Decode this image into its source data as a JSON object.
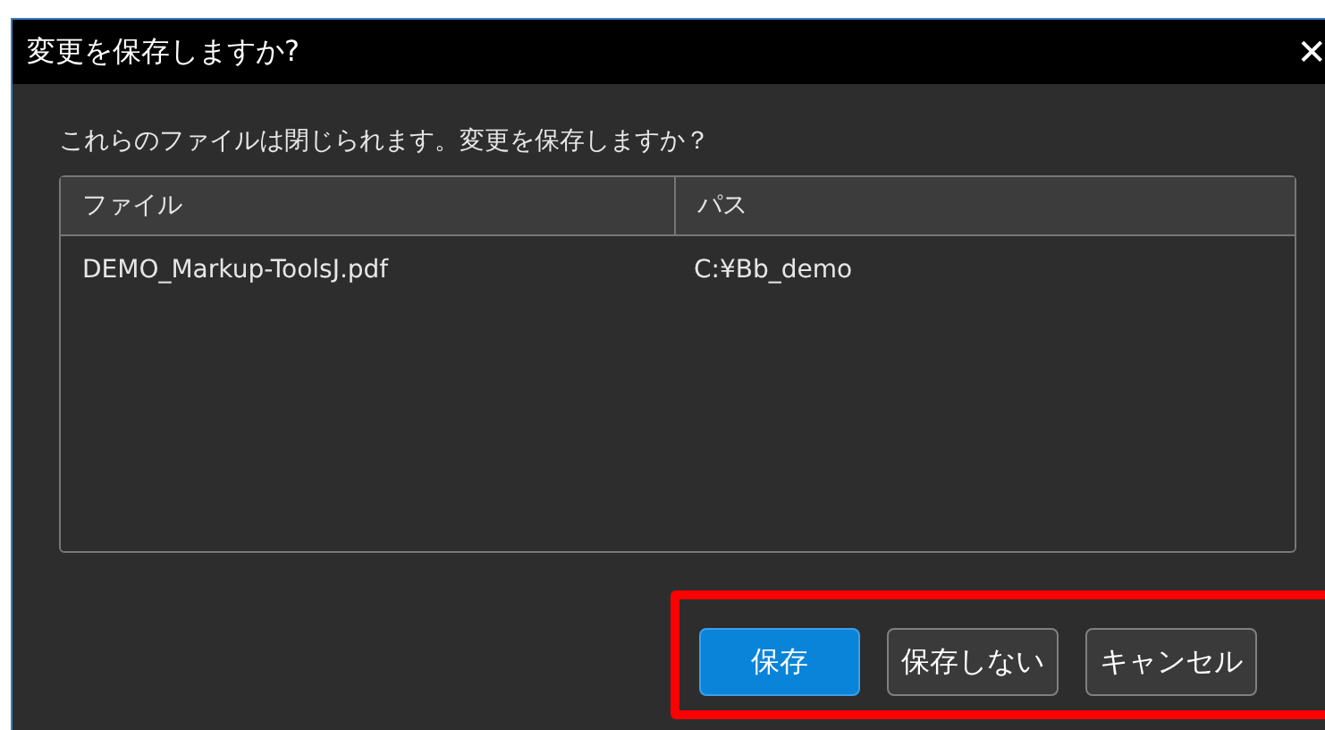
{
  "window": {
    "title": "変更を保存しますか?",
    "close": "✕"
  },
  "message": "これらのファイルは閉じられます。変更を保存しますか？",
  "table": {
    "columns": [
      "ファイル",
      "パス"
    ],
    "rows": [
      [
        "DEMO_Markup-ToolsJ.pdf",
        "C:¥Bb_demo"
      ]
    ]
  },
  "buttons": [
    {
      "label": "保存",
      "kind": "primary"
    },
    {
      "label": "保存しない",
      "kind": "default"
    },
    {
      "label": "キャンセル",
      "kind": "default"
    }
  ]
}
